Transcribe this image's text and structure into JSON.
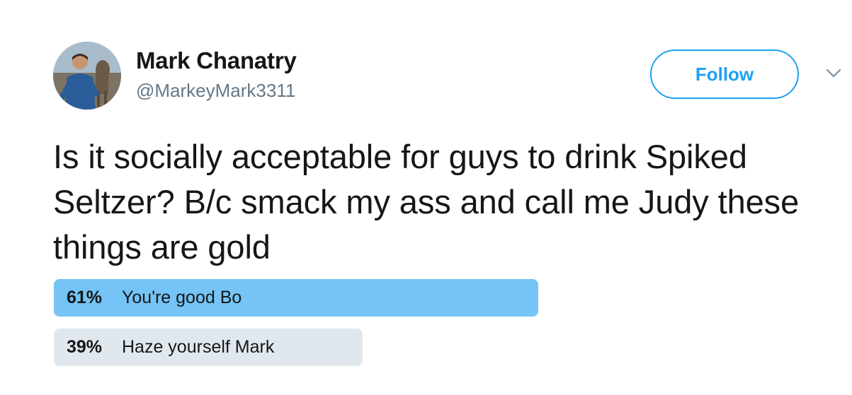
{
  "author": {
    "display_name": "Mark Chanatry",
    "handle": "@MarkeyMark3311",
    "avatar_icon": "profile-photo"
  },
  "header": {
    "follow_label": "Follow",
    "menu_icon": "chevron-down-icon"
  },
  "tweet": {
    "text": "Is it socially acceptable for guys to drink Spiked Seltzer? B/c smack my ass and call me Judy these things are gold"
  },
  "poll": {
    "options": [
      {
        "percent": "61%",
        "label": "You're good Bo",
        "fraction": 0.61,
        "leading": true
      },
      {
        "percent": "39%",
        "label": "Haze yourself Mark",
        "fraction": 0.39,
        "leading": false
      }
    ]
  },
  "colors": {
    "accent": "#1da1f2",
    "winning_bar": "#75c4f5",
    "losing_bar": "#e1e8ed",
    "secondary_text": "#657786",
    "primary_text": "#14171a"
  }
}
